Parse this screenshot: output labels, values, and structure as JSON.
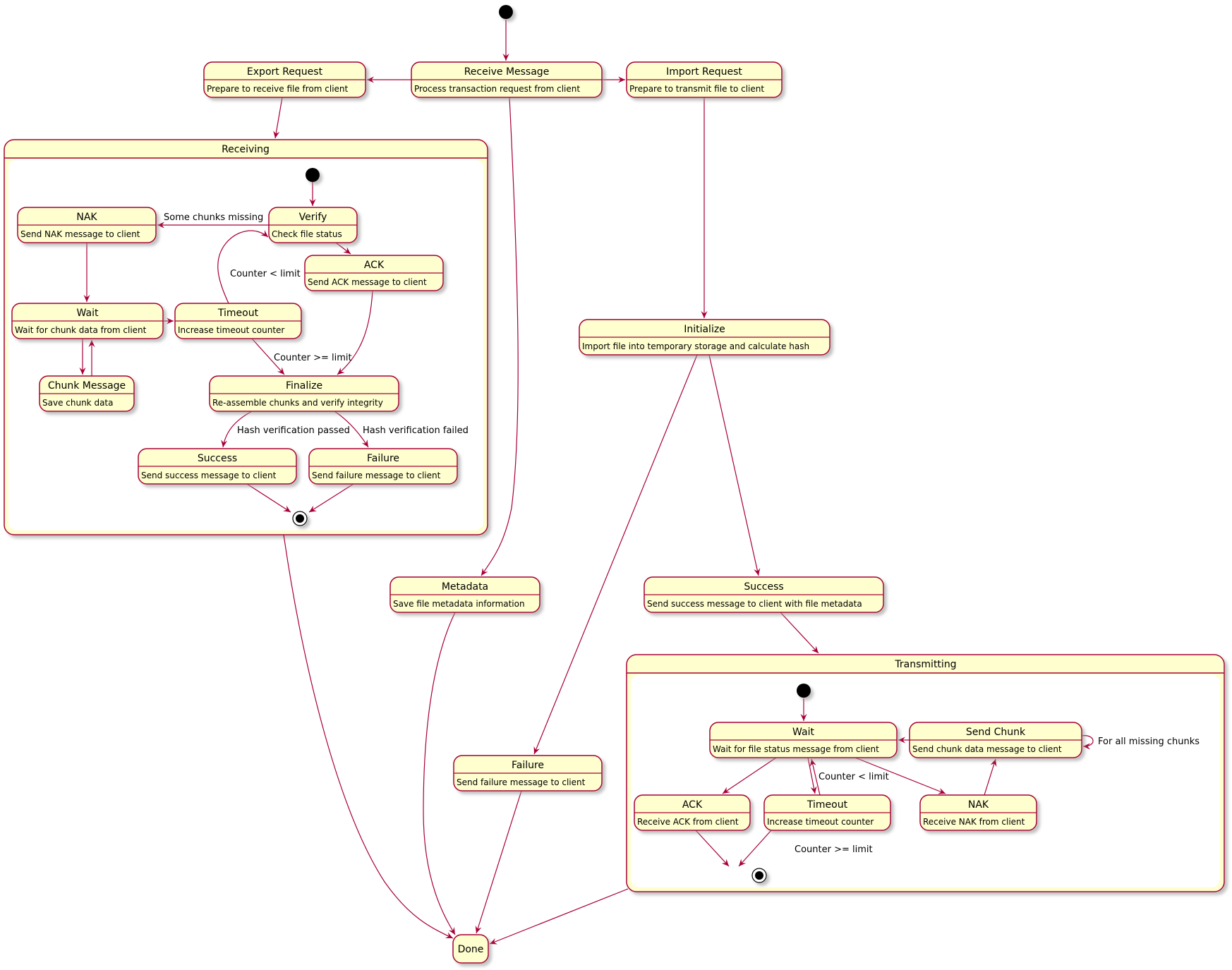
{
  "diagram": {
    "type": "state-diagram",
    "colors": {
      "state_fill": "#FEFECE",
      "border": "#A80036",
      "arrow": "#A80036",
      "composite_inner": "#FFFFFF",
      "initial": "#000000",
      "shadow": "#BBBBBB"
    },
    "top_level": {
      "states": [
        {
          "id": "receive_message",
          "name": "Receive Message",
          "desc": "Process transaction request from client"
        },
        {
          "id": "export_request",
          "name": "Export Request",
          "desc": "Prepare to receive file from client"
        },
        {
          "id": "import_request",
          "name": "Import Request",
          "desc": "Prepare to transmit file to client"
        },
        {
          "id": "initialize",
          "name": "Initialize",
          "desc": "Import file into temporary storage and calculate hash"
        },
        {
          "id": "metadata",
          "name": "Metadata",
          "desc": "Save file metadata information"
        },
        {
          "id": "success",
          "name": "Success",
          "desc": "Send success message to client with file metadata"
        },
        {
          "id": "failure",
          "name": "Failure",
          "desc": "Send failure message to client"
        },
        {
          "id": "done",
          "name": "Done",
          "desc": ""
        }
      ]
    },
    "receiving": {
      "name": "Receiving",
      "states": [
        {
          "id": "r_verify",
          "name": "Verify",
          "desc": "Check file status"
        },
        {
          "id": "r_nak",
          "name": "NAK",
          "desc": "Send NAK message to client"
        },
        {
          "id": "r_ack",
          "name": "ACK",
          "desc": "Send ACK message to client"
        },
        {
          "id": "r_wait",
          "name": "Wait",
          "desc": "Wait for chunk data from client"
        },
        {
          "id": "r_timeout",
          "name": "Timeout",
          "desc": "Increase timeout counter"
        },
        {
          "id": "r_chunk",
          "name": "Chunk Message",
          "desc": "Save chunk data"
        },
        {
          "id": "r_finalize",
          "name": "Finalize",
          "desc": "Re-assemble chunks and verify integrity"
        },
        {
          "id": "r_success",
          "name": "Success",
          "desc": "Send success message to client"
        },
        {
          "id": "r_failure",
          "name": "Failure",
          "desc": "Send failure message to client"
        }
      ]
    },
    "transmitting": {
      "name": "Transmitting",
      "states": [
        {
          "id": "t_wait",
          "name": "Wait",
          "desc": "Wait for file status message from client"
        },
        {
          "id": "t_sendchunk",
          "name": "Send Chunk",
          "desc": "Send chunk data message to client"
        },
        {
          "id": "t_ack",
          "name": "ACK",
          "desc": "Receive ACK from client"
        },
        {
          "id": "t_timeout",
          "name": "Timeout",
          "desc": "Increase timeout counter"
        },
        {
          "id": "t_nak",
          "name": "NAK",
          "desc": "Receive NAK from client"
        }
      ]
    },
    "transitions": [
      {
        "from": "[*]",
        "to": "Receive Message",
        "label": ""
      },
      {
        "from": "Receive Message",
        "to": "Export Request",
        "label": ""
      },
      {
        "from": "Receive Message",
        "to": "Import Request",
        "label": ""
      },
      {
        "from": "Receive Message",
        "to": "Metadata",
        "label": ""
      },
      {
        "from": "Export Request",
        "to": "Receiving",
        "label": ""
      },
      {
        "from": "Import Request",
        "to": "Initialize",
        "label": ""
      },
      {
        "from": "Initialize",
        "to": "Success",
        "label": ""
      },
      {
        "from": "Initialize",
        "to": "Failure",
        "label": ""
      },
      {
        "from": "Success",
        "to": "Transmitting",
        "label": ""
      },
      {
        "from": "Receiving",
        "to": "Done",
        "label": ""
      },
      {
        "from": "Metadata",
        "to": "Done",
        "label": ""
      },
      {
        "from": "Failure",
        "to": "Done",
        "label": ""
      },
      {
        "from": "Transmitting",
        "to": "Done",
        "label": ""
      },
      {
        "from": "Receiving.[*]",
        "to": "Verify",
        "label": ""
      },
      {
        "from": "Verify",
        "to": "NAK",
        "label": "Some chunks missing"
      },
      {
        "from": "Verify",
        "to": "ACK",
        "label": ""
      },
      {
        "from": "NAK",
        "to": "Wait",
        "label": ""
      },
      {
        "from": "Wait",
        "to": "Timeout",
        "label": ""
      },
      {
        "from": "Wait",
        "to": "Chunk Message",
        "label": ""
      },
      {
        "from": "Chunk Message",
        "to": "Wait",
        "label": ""
      },
      {
        "from": "Timeout",
        "to": "Verify",
        "label": "Counter < limit"
      },
      {
        "from": "Timeout",
        "to": "Finalize",
        "label": "Counter >= limit"
      },
      {
        "from": "ACK",
        "to": "Finalize",
        "label": ""
      },
      {
        "from": "Finalize",
        "to": "Success",
        "label": "Hash verification passed"
      },
      {
        "from": "Finalize",
        "to": "Failure",
        "label": "Hash verification failed"
      },
      {
        "from": "Success",
        "to": "Receiving.[*]",
        "label": ""
      },
      {
        "from": "Failure",
        "to": "Receiving.[*]",
        "label": ""
      },
      {
        "from": "Transmitting.[*]",
        "to": "Wait",
        "label": ""
      },
      {
        "from": "Send Chunk",
        "to": "Wait",
        "label": ""
      },
      {
        "from": "Send Chunk",
        "to": "Send Chunk",
        "label": "For all missing chunks"
      },
      {
        "from": "Wait",
        "to": "ACK",
        "label": ""
      },
      {
        "from": "Wait",
        "to": "Timeout",
        "label": ""
      },
      {
        "from": "Timeout",
        "to": "Wait",
        "label": "Counter < limit"
      },
      {
        "from": "Wait",
        "to": "NAK",
        "label": ""
      },
      {
        "from": "NAK",
        "to": "Send Chunk",
        "label": ""
      },
      {
        "from": "ACK",
        "to": "Transmitting.[*]",
        "label": ""
      },
      {
        "from": "Timeout",
        "to": "Transmitting.[*]",
        "label": "Counter >= limit"
      }
    ],
    "edge_labels": {
      "r_missing": "Some chunks missing",
      "r_counter_lt": "Counter < limit",
      "r_counter_ge": "Counter >= limit",
      "r_hash_passed": "Hash verification passed",
      "r_hash_failed": "Hash verification failed",
      "t_all_missing": "For all missing chunks",
      "t_counter_lt": "Counter < limit",
      "t_counter_ge": "Counter >= limit"
    }
  }
}
